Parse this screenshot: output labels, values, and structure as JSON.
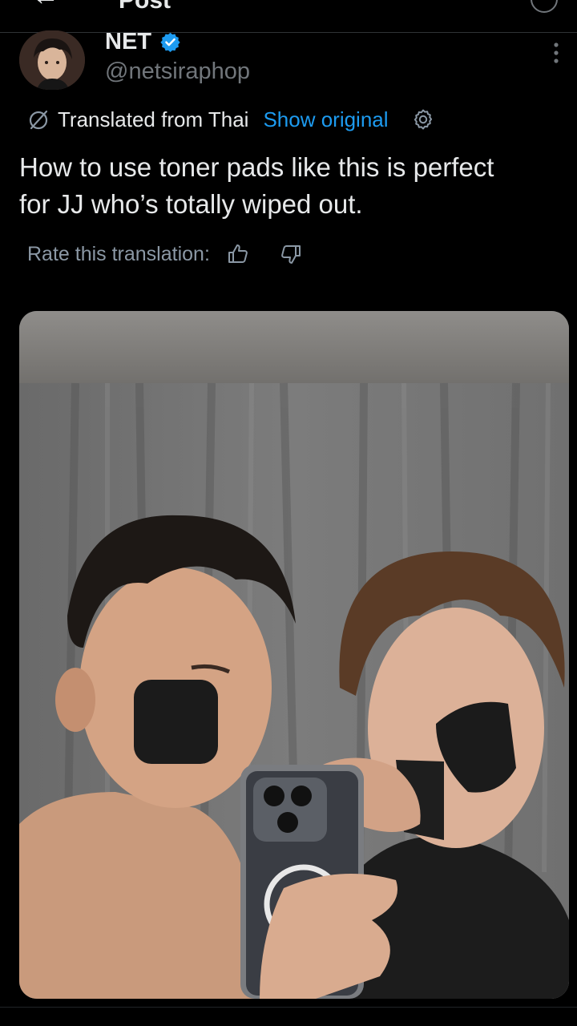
{
  "header": {
    "back_glyph": "←",
    "title": "Post"
  },
  "post": {
    "author": {
      "display_name": "NET",
      "handle": "@netsiraphop",
      "verified": true
    },
    "translation": {
      "translated_from": "Translated from Thai",
      "show_original": "Show original"
    },
    "text_line1": "How to use toner pads like this is perfect",
    "text_line2": "for JJ who’s totally wiped out.",
    "rate_label": "Rate this translation:",
    "media_alt": "Photo"
  },
  "icons": {
    "verified": "verified-badge-icon",
    "more": "more-vertical-icon",
    "globe": "globe-icon",
    "gear": "gear-icon",
    "thumb_up": "thumbs-up-icon",
    "thumb_down": "thumbs-down-icon"
  },
  "colors": {
    "background": "#000000",
    "text_primary": "#e7e9ea",
    "text_secondary": "#71767b",
    "accent": "#1d9bf0"
  }
}
